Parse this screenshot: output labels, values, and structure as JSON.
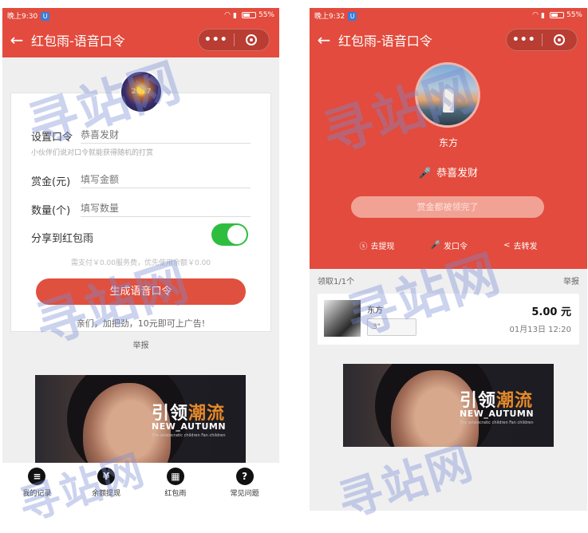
{
  "left": {
    "status": {
      "time": "晚上9:30",
      "battery": "55%"
    },
    "nav": {
      "title": "红包雨-语音口令",
      "back": "←",
      "more": "•••"
    },
    "avatar_text": "2017",
    "form": {
      "password_label": "设置口令",
      "password_placeholder": "恭喜发财",
      "password_hint": "小伙伴们说对口令就能获得随机的打赏",
      "amount_label": "赏金(元)",
      "amount_placeholder": "填写金额",
      "count_label": "数量(个)",
      "count_placeholder": "填写数量",
      "share_label": "分享到红包雨",
      "share_enabled": true,
      "fee_text": "需支付￥0.00服务费，优先使用余额￥0.00",
      "generate_button": "生成语音口令",
      "promo_text": "亲们，加把劲，10元即可上广告!"
    },
    "report": "举报",
    "ad": {
      "title_white": "引领",
      "title_accent": "潮流",
      "subtitle": "NEW_AUTUMN",
      "tagline": "The aristocratic children Fan children"
    },
    "tabbar": [
      {
        "label": "我的记录",
        "icon": "list-icon",
        "glyph": "≡"
      },
      {
        "label": "余额提现",
        "icon": "yen-icon",
        "glyph": "¥"
      },
      {
        "label": "红包雨",
        "icon": "grid-icon",
        "glyph": "▦"
      },
      {
        "label": "常见问题",
        "icon": "question-icon",
        "glyph": "?"
      }
    ]
  },
  "right": {
    "status": {
      "time": "晚上9:32",
      "battery": "55%"
    },
    "nav": {
      "title": "红包雨-语音口令",
      "back": "←",
      "more": "•••"
    },
    "name": "东方",
    "password": "恭喜发财",
    "status_button": "赏金都被领完了",
    "actions": [
      {
        "label": "去提现",
        "icon": "withdraw-icon",
        "glyph": "⓪"
      },
      {
        "label": "发口令",
        "icon": "mic-icon",
        "glyph": "🎤"
      },
      {
        "label": "去转发",
        "icon": "share-icon",
        "glyph": "<"
      }
    ],
    "list_header": "领取1/1个",
    "report": "举报",
    "record": {
      "name": "东方",
      "voice_length": "3\"",
      "amount": "5.00 元",
      "time": "01月13日 12:20"
    },
    "ad": {
      "title_white": "引领",
      "title_accent": "潮流",
      "subtitle": "NEW_AUTUMN",
      "tagline": "The aristocratic children Fan children"
    }
  },
  "watermark": "寻站网",
  "colors": {
    "primary_red": "#e24b3d",
    "toggle_green": "#2ebe3f",
    "button_disabled": "#f2a294"
  }
}
